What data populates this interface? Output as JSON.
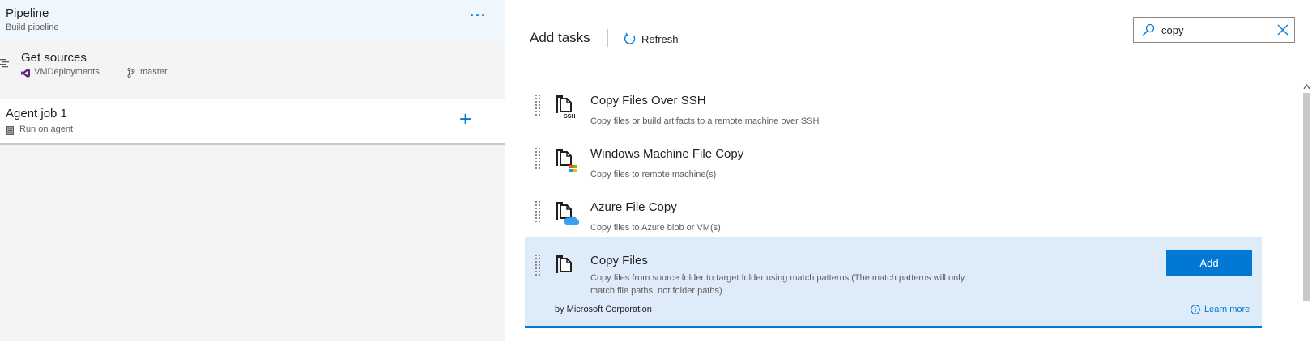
{
  "left": {
    "pipeline": {
      "title": "Pipeline",
      "subtitle": "Build pipeline",
      "more": "···"
    },
    "get_sources": {
      "title": "Get sources",
      "repo": "VMDeployments",
      "branch": "master"
    },
    "agent_job": {
      "title": "Agent job 1",
      "subtitle": "Run on agent",
      "add": "+"
    }
  },
  "right": {
    "header": {
      "title": "Add tasks",
      "refresh_label": "Refresh"
    },
    "search": {
      "value": "copy",
      "icon": "search-icon",
      "clear_icon": "close-icon"
    },
    "tasks": [
      {
        "name": "Copy Files Over SSH",
        "description": "Copy files or build artifacts to a remote machine over SSH",
        "icon": "copy-ssh-icon"
      },
      {
        "name": "Windows Machine File Copy",
        "description": "Copy files to remote machine(s)",
        "icon": "windows-file-copy-icon"
      },
      {
        "name": "Azure File Copy",
        "description": "Copy files to Azure blob or VM(s)",
        "icon": "azure-file-copy-icon"
      },
      {
        "name": "Copy Files",
        "description": "Copy files from source folder to target folder using match patterns (The match patterns will only match file paths, not folder paths)",
        "icon": "copy-files-icon",
        "publisher": "by Microsoft Corporation",
        "add_label": "Add",
        "learn_more": "Learn more"
      }
    ]
  },
  "colors": {
    "accent": "#0078d4",
    "selected_bg": "#deecf9",
    "pipeline_bg": "#eff6fc",
    "left_bg": "#f4f4f4"
  }
}
